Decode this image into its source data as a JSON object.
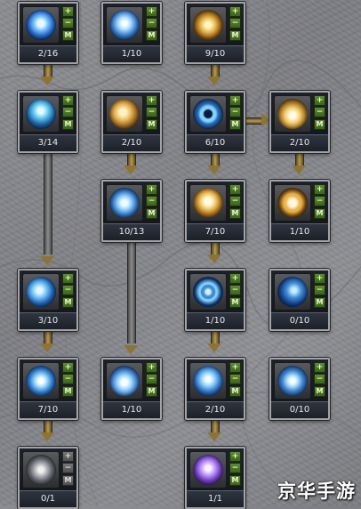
{
  "skill_tree": {
    "nodes": [
      {
        "id": "r1c1",
        "level": "2/16",
        "icon": "blue-rune-orb-icon",
        "locked": false
      },
      {
        "id": "r1c2",
        "level": "1/10",
        "icon": "blue-spirit-bird-icon",
        "locked": false
      },
      {
        "id": "r1c3",
        "level": "9/10",
        "icon": "golden-cross-shield-icon",
        "locked": false
      },
      {
        "id": "r2c1",
        "level": "3/14",
        "icon": "blue-aura-figure-icon",
        "locked": false
      },
      {
        "id": "r2c2",
        "level": "2/10",
        "icon": "golden-hand-icon",
        "locked": false
      },
      {
        "id": "r2c3",
        "level": "6/10",
        "icon": "blue-ring-icon",
        "locked": false
      },
      {
        "id": "r2c4",
        "level": "2/10",
        "icon": "golden-crown-light-icon",
        "locked": false
      },
      {
        "id": "r3c2",
        "level": "10/13",
        "icon": "blue-spirit-form-icon",
        "locked": false
      },
      {
        "id": "r3c3",
        "level": "7/10",
        "icon": "golden-aura-icon",
        "locked": false
      },
      {
        "id": "r3c4",
        "level": "1/10",
        "icon": "golden-ring-glow-icon",
        "locked": false
      },
      {
        "id": "r4c1",
        "level": "3/10",
        "icon": "blue-swirl-icon",
        "locked": false
      },
      {
        "id": "r4c3",
        "level": "1/10",
        "icon": "blue-crosshair-icon",
        "locked": false
      },
      {
        "id": "r4c4",
        "level": "0/10",
        "icon": "blue-vortex-icon",
        "locked": false
      },
      {
        "id": "r5c1",
        "level": "7/10",
        "icon": "blue-storm-icon",
        "locked": false
      },
      {
        "id": "r5c2",
        "level": "1/10",
        "icon": "blue-flame-icon",
        "locked": false
      },
      {
        "id": "r5c3",
        "level": "2/10",
        "icon": "blue-portal-icon",
        "locked": false
      },
      {
        "id": "r5c4",
        "level": "0/10",
        "icon": "blue-starburst-icon",
        "locked": false
      },
      {
        "id": "r6c1",
        "level": "0/1",
        "icon": "grey-gear-rune-icon",
        "locked": true
      },
      {
        "id": "r6c3",
        "level": "1/1",
        "icon": "purple-spirit-icon",
        "locked": false
      }
    ],
    "controls": {
      "plus": "+",
      "minus": "−",
      "max": "M"
    },
    "colors": {
      "panel_bg": "#11141a",
      "frame": "#a1a3a8",
      "plus_button": "#5e8b32",
      "link_gold": "#b79a52",
      "link_grey": "#8d8d8d"
    }
  },
  "watermark": {
    "text": "京华手游"
  }
}
